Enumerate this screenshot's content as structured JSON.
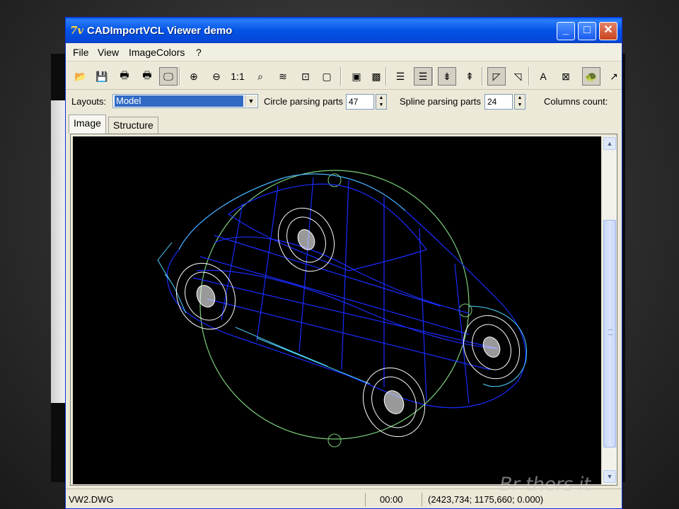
{
  "window": {
    "title": "CADImportVCL Viewer demo",
    "app_icon_glyph": "7v",
    "controls": {
      "minimize": "_",
      "maximize": "□",
      "close": "✕"
    }
  },
  "menu": {
    "items": [
      {
        "label": "File"
      },
      {
        "label": "View"
      },
      {
        "label": "ImageColors"
      },
      {
        "label": "?"
      }
    ]
  },
  "toolbar": {
    "tools": [
      {
        "icon": "open-folder-icon",
        "glyph": "📂"
      },
      {
        "icon": "save-icon",
        "glyph": "💾"
      },
      {
        "icon": "print-icon",
        "glyph": "🖶"
      },
      {
        "icon": "print-preview-icon",
        "glyph": "🖶"
      },
      {
        "icon": "scanner-icon",
        "glyph": "🖵",
        "pressed": true
      },
      {
        "icon": "zoom-in-icon",
        "glyph": "⊕"
      },
      {
        "icon": "zoom-out-icon",
        "glyph": "⊖"
      },
      {
        "icon": "actual-size-icon",
        "glyph": "1:1"
      },
      {
        "icon": "zoom-fit-icon",
        "glyph": "⌕"
      },
      {
        "icon": "layers-icon",
        "glyph": "≋"
      },
      {
        "icon": "rotate-icon",
        "glyph": "⊡"
      },
      {
        "icon": "frame-icon",
        "glyph": "▢"
      },
      {
        "icon": "color-scheme-icon",
        "glyph": "▣"
      },
      {
        "icon": "black-white-icon",
        "glyph": "▩"
      },
      {
        "icon": "list-icon",
        "glyph": "☰"
      },
      {
        "icon": "list-pressed-icon",
        "glyph": "☰",
        "pressed": true
      },
      {
        "icon": "fit-width-icon",
        "glyph": "⇟",
        "pressed": true
      },
      {
        "icon": "fit-height-icon",
        "glyph": "⇞"
      },
      {
        "icon": "dimension-pressed-icon",
        "glyph": "◸",
        "pressed": true
      },
      {
        "icon": "dimension-icon",
        "glyph": "◹"
      },
      {
        "icon": "text-icon",
        "glyph": "A"
      },
      {
        "icon": "no-fill-icon",
        "glyph": "⊠"
      },
      {
        "icon": "turtle-icon",
        "glyph": "🐢",
        "pressed": true
      },
      {
        "icon": "axes-icon",
        "glyph": "↗"
      }
    ]
  },
  "params": {
    "layouts_label": "Layouts:",
    "layouts_value": "Model",
    "circle_label": "Circle parsing parts",
    "circle_value": "47",
    "spline_label": "Spline parsing parts",
    "spline_value": "24",
    "columns_label": "Columns count:"
  },
  "tabs": [
    {
      "label": "Image",
      "active": true
    },
    {
      "label": "Structure",
      "active": false
    }
  ],
  "canvas": {
    "drawing_colors": {
      "background": "#000000",
      "body_wire": "#1a2cff",
      "accent_wire": "#4fd2ff",
      "wheel_wire": "#ffffff",
      "orbit_circle": "#7ad07a"
    }
  },
  "status": {
    "file": "VW2.DWG",
    "time": "00:00",
    "coords": "(2423,734; 1175,660; 0.000)"
  },
  "watermark": "Br thers it"
}
